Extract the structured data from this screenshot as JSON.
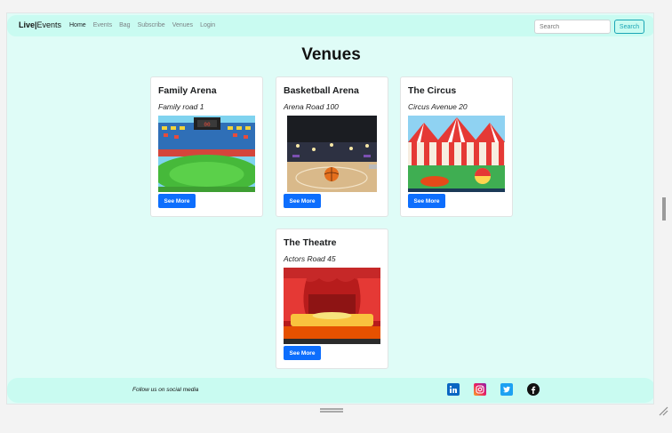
{
  "navbar": {
    "brand_bold": "Live",
    "brand_sep": "|",
    "brand_rest": "Events",
    "links": [
      "Home",
      "Events",
      "Bag",
      "Subscribe",
      "Venues",
      "Login"
    ],
    "search_placeholder": "Search",
    "search_button": "Search"
  },
  "page": {
    "title": "Venues"
  },
  "venues": [
    {
      "name": "Family Arena",
      "address": "Family road 1",
      "button": "See More"
    },
    {
      "name": "Basketball Arena",
      "address": "Arena Road 100",
      "button": "See More"
    },
    {
      "name": "The Circus",
      "address": "Circus Avenue 20",
      "button": "See More"
    },
    {
      "name": "The Theatre",
      "address": "Actors Road 45",
      "button": "See More"
    }
  ],
  "footer": {
    "follow_text": "Follow us on social media",
    "social": [
      "linkedin-icon",
      "instagram-icon",
      "twitter-icon",
      "facebook-icon"
    ]
  },
  "colors": {
    "page_bg": "#dffcf7",
    "navbar_bg": "#c9fbf1",
    "primary": "#0d6efd",
    "search_accent": "#1aa5b5"
  }
}
